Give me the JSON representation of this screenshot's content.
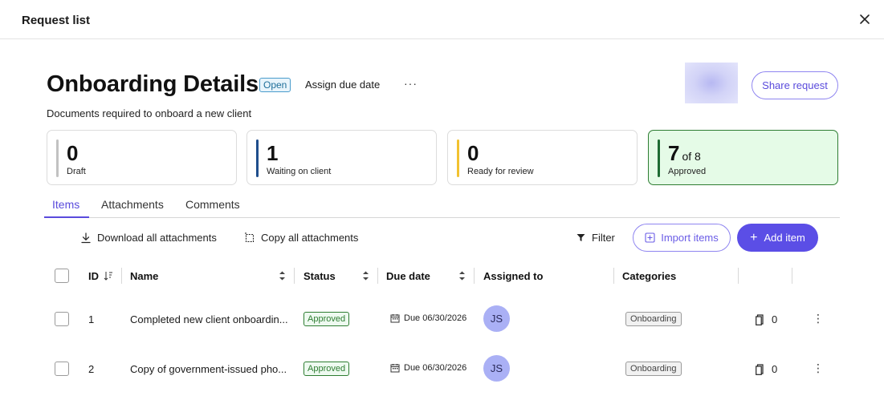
{
  "topbar": {
    "title": "Request list",
    "close_icon": "close-icon"
  },
  "header": {
    "title": "Onboarding Details",
    "status_badge": "Open",
    "assign_due_date": "Assign due date",
    "more": "···",
    "subtitle": "Documents required to onboard a new client",
    "share_button": "Share request"
  },
  "stats": [
    {
      "value": "0",
      "label": "Draft",
      "color": "#c2c2c2"
    },
    {
      "value": "1",
      "label": "Waiting on client",
      "color": "#1f4e8c"
    },
    {
      "value": "0",
      "label": "Ready for review",
      "color": "#f2c230"
    },
    {
      "value": "7",
      "suffix": "of 8",
      "label": "Approved",
      "color": "#1e6b32"
    }
  ],
  "tabs": [
    "Items",
    "Attachments",
    "Comments"
  ],
  "toolbar": {
    "download_all": "Download all attachments",
    "copy_all": "Copy all attachments",
    "filter": "Filter",
    "import_items": "Import items",
    "add_item": "Add item"
  },
  "table": {
    "columns": [
      "ID",
      "Name",
      "Status",
      "Due date",
      "Assigned to",
      "Categories"
    ],
    "rows": [
      {
        "id": "1",
        "name": "Completed new client onboardin...",
        "status": "Approved",
        "due": "Due 06/30/2026",
        "assignee": "JS",
        "category": "Onboarding",
        "attachments": "0"
      },
      {
        "id": "2",
        "name": "Copy of government-issued pho...",
        "status": "Approved",
        "due": "Due 06/30/2026",
        "assignee": "JS",
        "category": "Onboarding",
        "attachments": "0"
      }
    ]
  },
  "colors": {
    "accent": "#5b4ee6",
    "approved": "#2e7d32",
    "open": "#1f6f9a"
  }
}
